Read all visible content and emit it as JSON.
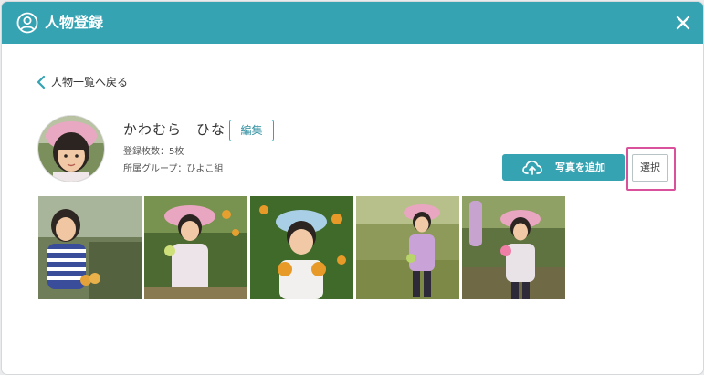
{
  "dialog": {
    "title": "人物登録",
    "icons": {
      "title": "person-circle-icon",
      "close": "close-icon"
    }
  },
  "back_link": {
    "label": "人物一覧へ戻る",
    "icon": "chevron-left-icon"
  },
  "person": {
    "name": "かわむら　ひな",
    "edit_label": "編集",
    "registered_count": "登録枚数：5枚",
    "group": "所属グループ：ひよこ組"
  },
  "actions": {
    "add_photo_label": "写真を追加",
    "add_photo_icon": "cloud-upload-icon",
    "select_label": "選択"
  },
  "photos": [
    {
      "name": "photo-girl-striped-shirt"
    },
    {
      "name": "photo-girl-pink-hat-orange"
    },
    {
      "name": "photo-girl-blue-hat-oranges"
    },
    {
      "name": "photo-girl-pink-hat-field"
    },
    {
      "name": "photo-girl-pink-hat-orchard"
    }
  ],
  "colors": {
    "accent": "#36a3b3",
    "highlight": "#d9509b"
  }
}
